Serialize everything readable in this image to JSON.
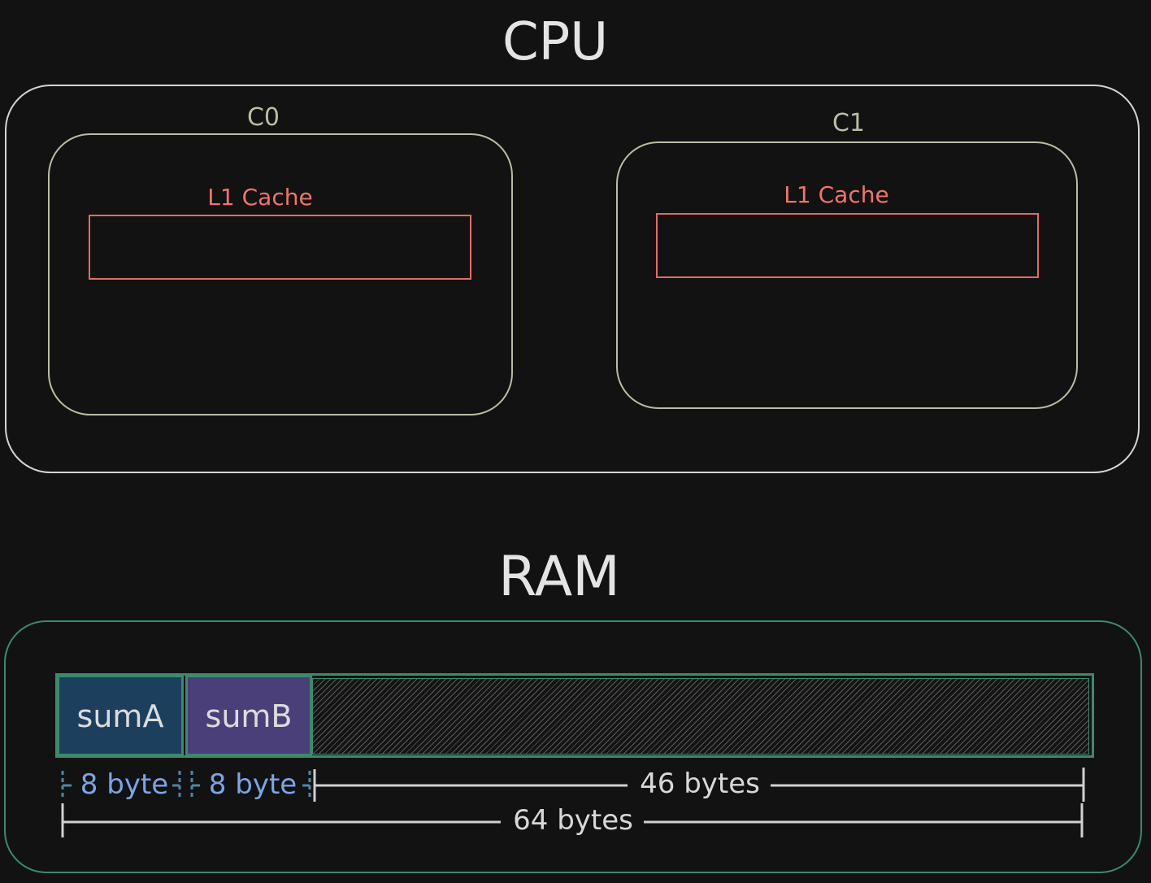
{
  "cpu": {
    "title": "CPU",
    "cores": [
      {
        "label": "C0",
        "cache_label": "L1 Cache"
      },
      {
        "label": "C1",
        "cache_label": "L1 Cache"
      }
    ]
  },
  "ram": {
    "title": "RAM",
    "cells": [
      {
        "label": "sumA",
        "color": "#1d3f5e"
      },
      {
        "label": "sumB",
        "color": "#4b3f7a"
      }
    ],
    "measures": {
      "sumA_size": "8 byte",
      "sumB_size": "8 byte",
      "rest_size": "46 bytes",
      "total_size": "64 bytes"
    }
  },
  "colors": {
    "background": "#121212",
    "cpu_border": "#d4d4d4",
    "core_border": "#b9bea3",
    "cache": "#e46a62",
    "ram_border": "#3c8a6c",
    "measure_blue": "#79a6e8",
    "measure_grey": "#d8d8d8"
  }
}
